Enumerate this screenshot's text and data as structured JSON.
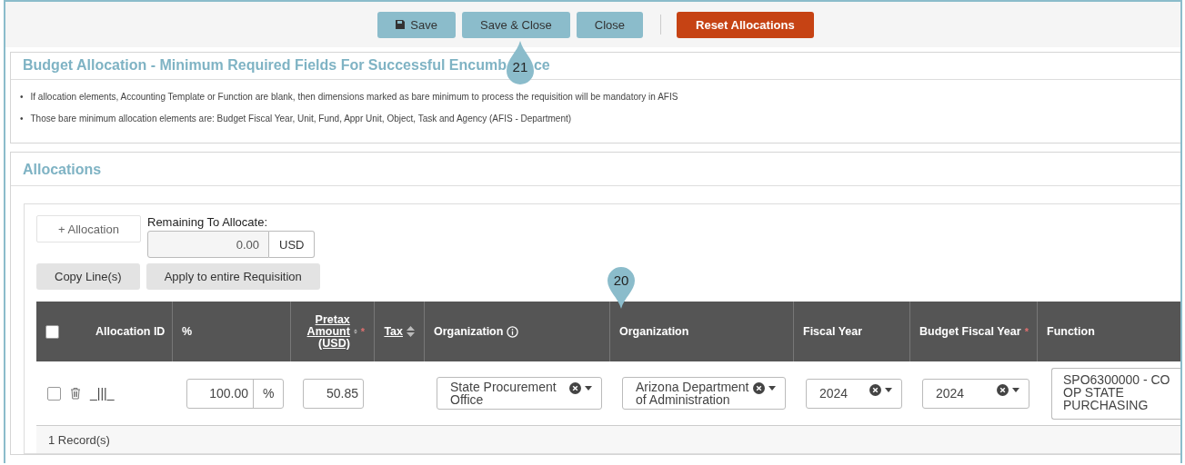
{
  "toolbar": {
    "buttons": [
      {
        "label": "Save",
        "kind": "save"
      },
      {
        "label": "Save & Close",
        "kind": "plain"
      },
      {
        "label": "Close",
        "kind": "plain"
      },
      {
        "label": "Reset Allocations",
        "kind": "danger"
      }
    ]
  },
  "budget_panel": {
    "title_start": "Budget Allocation - Minimum Required Fields For Successful Encumb",
    "callout": "21",
    "title_end": "ce",
    "notes": [
      {
        "bullet": "•",
        "text": "If allocation elements, Accounting Template or Function are blank, then dimensions marked as bare minimum to process  the requisition will be mandatory in AFIS"
      },
      {
        "bullet": "•",
        "text": "Those bare minimum allocation elements are: Budget Fiscal Year, Unit, Fund, Appr Unit, Object, Task and Agency (AFIS - Department)"
      }
    ]
  },
  "allocations_panel": {
    "title": "Allocations",
    "add_button": "+ Allocation",
    "remaining": {
      "label": "Remaining To Allocate:",
      "value": "0.00",
      "unit": "USD"
    },
    "actions": [
      "Copy Line(s)",
      "Apply to entire Requisition"
    ],
    "callout": "20",
    "table": {
      "select_all_checked": false,
      "columns": [
        {
          "label": "Allocation ID",
          "kind": "id"
        },
        {
          "label": "%",
          "kind": "percent"
        },
        {
          "label": "Pretax Amount (USD)",
          "kind": "amount",
          "required_mark": "*"
        },
        {
          "label": "Tax",
          "kind": "tax"
        },
        {
          "label": "Organization",
          "kind": "lookup"
        },
        {
          "label": "Organization",
          "kind": "select"
        },
        {
          "label": "Fiscal Year",
          "kind": "select"
        },
        {
          "label": "Budget Fiscal Year",
          "kind": "select",
          "required_mark": "*"
        },
        {
          "label": "Function",
          "kind": "textarea"
        }
      ],
      "rows": [
        {
          "checked": false,
          "cells": [
            {
              "text": "_|||_"
            },
            {
              "value": "100.00",
              "unit": "%"
            },
            {
              "value": "50.85"
            },
            null,
            {
              "value": "State Procurement Office"
            },
            {
              "value": "Arizona Department of Administration"
            },
            {
              "value": "2024"
            },
            {
              "value": "2024"
            },
            {
              "value": "SPO6300000 - CO OP STATE PURCHASING"
            }
          ]
        }
      ],
      "footer": "1 Record(s)"
    }
  }
}
